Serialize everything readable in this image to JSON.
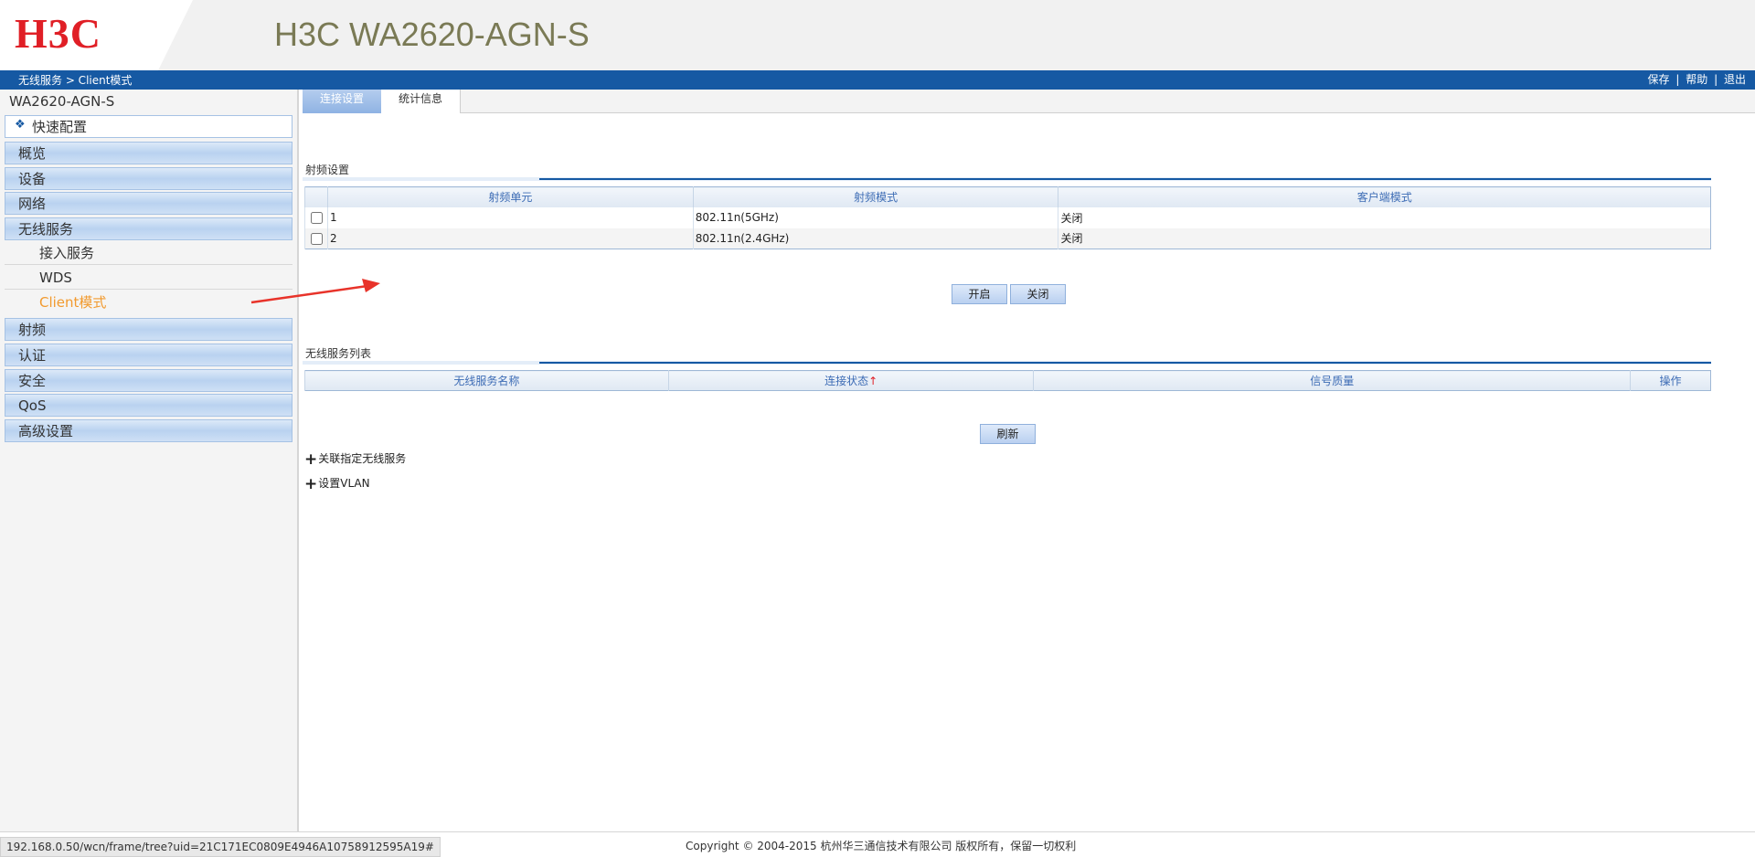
{
  "header": {
    "logo": "H3C",
    "model_title": "H3C WA2620-AGN-S"
  },
  "bluebar": {
    "breadcrumb": "无线服务 > Client模式",
    "save": "保存",
    "help": "帮助",
    "logout": "退出",
    "separator": "|"
  },
  "sidebar": {
    "device_name": "WA2620-AGN-S",
    "quick_config": "快速配置",
    "items": {
      "overview": "概览",
      "device": "设备",
      "network": "网络",
      "wireless": "无线服务",
      "radio": "射频",
      "auth": "认证",
      "security": "安全",
      "qos": "QoS",
      "advanced": "高级设置"
    },
    "sub_items": {
      "access_service": "接入服务",
      "wds": "WDS",
      "client_mode": "Client模式"
    }
  },
  "tabs": {
    "connection": "连接设置",
    "statistics": "统计信息"
  },
  "radio_section": {
    "title": "射频设置",
    "columns": [
      "射频单元",
      "射频模式",
      "客户端模式"
    ],
    "rows": [
      {
        "unit": "1",
        "mode": "802.11n(5GHz)",
        "client_mode": "关闭"
      },
      {
        "unit": "2",
        "mode": "802.11n(2.4GHz)",
        "client_mode": "关闭"
      }
    ],
    "enable_button": "开启",
    "disable_button": "关闭"
  },
  "service_section": {
    "title": "无线服务列表",
    "columns": [
      "无线服务名称",
      "连接状态",
      "信号质量",
      "操作"
    ],
    "sort_indicator": "↑",
    "refresh_button": "刷新"
  },
  "expand_sections": {
    "plus": "+",
    "associate": "关联指定无线服务",
    "vlan": "设置VLAN"
  },
  "footer": {
    "status_url": "192.168.0.50/wcn/frame/tree?uid=21C171EC0809E4946A10758912595A19#",
    "copyright": "Copyright © 2004-2015 杭州华三通信技术有限公司 版权所有，保留一切权利"
  },
  "colors": {
    "brand_red": "#e01f26",
    "bar_blue": "#1659a3",
    "active_orange": "#f29a2e",
    "annotation_arrow": "#e8332a"
  }
}
